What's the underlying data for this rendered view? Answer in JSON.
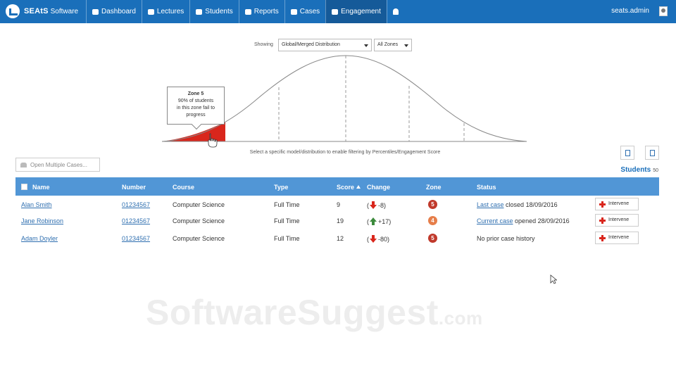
{
  "app": {
    "brand_name": "SEAtS",
    "brand_sub": "Software"
  },
  "nav": {
    "items": [
      {
        "label": "Dashboard",
        "icon": "dashboard-icon",
        "active": false
      },
      {
        "label": "Lectures",
        "icon": "book-icon",
        "active": false
      },
      {
        "label": "Students",
        "icon": "graduation-cap-icon",
        "active": false
      },
      {
        "label": "Reports",
        "icon": "file-icon",
        "active": false
      },
      {
        "label": "Cases",
        "icon": "edit-icon",
        "active": false
      },
      {
        "label": "Engagement",
        "icon": "users-icon",
        "active": true
      }
    ],
    "bell_icon": "bell-icon",
    "user": "seats.admin"
  },
  "filters": {
    "showing_label": "Showing",
    "distribution": "Global/Merged Distribution",
    "zones": "All Zones"
  },
  "distribution_chart": {
    "tooltip_title": "Zone 5",
    "tooltip_lines": [
      "90% of students",
      "in this zone fail to",
      "progress"
    ],
    "hint": "Select a specific model/distribution to enable filtering by Percentiles/Engagement Score",
    "highlighted_zone_color": "#d9261c"
  },
  "actions": {
    "open_cases": "Open Multiple Cases...",
    "students_label": "Students",
    "students_count": "50"
  },
  "table": {
    "headers": {
      "name": "Name",
      "number": "Number",
      "course": "Course",
      "type": "Type",
      "score": "Score",
      "change": "Change",
      "zone": "Zone",
      "status": "Status"
    },
    "rows": [
      {
        "name": "Alan Smith",
        "number": "01234567",
        "course": "Computer Science",
        "type": "Full Time",
        "score": "9",
        "change_prefix": "(",
        "change_dir": "down",
        "change": "-8)",
        "zone": "5",
        "zone_color": "#c0392b",
        "status_link": "Last case",
        "status_text": "closed 18/09/2016",
        "action": "Intervene"
      },
      {
        "name": "Jane Robinson",
        "number": "01234567",
        "course": "Computer Science",
        "type": "Full Time",
        "score": "19",
        "change_prefix": "(",
        "change_dir": "up",
        "change": "+17)",
        "zone": "4",
        "zone_color": "#e67e4a",
        "status_link": "Current case",
        "status_text": "opened 28/09/2016",
        "action": "Intervene"
      },
      {
        "name": "Adam Doyler",
        "number": "01234567",
        "course": "Computer Science",
        "type": "Full Time",
        "score": "12",
        "change_prefix": "(",
        "change_dir": "down",
        "change": "-80)",
        "zone": "5",
        "zone_color": "#c0392b",
        "status_link": "",
        "status_text": "No prior case history",
        "action": "Intervene"
      }
    ]
  },
  "watermark": {
    "main": "SoftwareSuggest",
    "suffix": ".com"
  }
}
